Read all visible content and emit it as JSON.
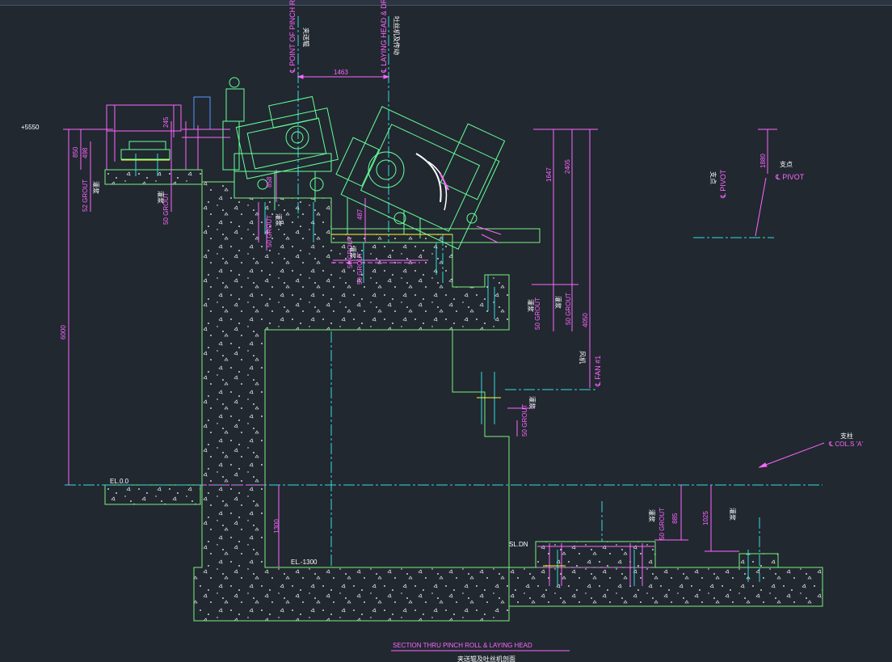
{
  "colors": {
    "background": "#212830",
    "concrete": "#7cf07c",
    "dimension": "#ff66ff",
    "centerline": "#33dddd",
    "equipment": "#66ff99",
    "white": "#ffffff",
    "yellow": "#ffff33",
    "blue": "#5599ff"
  },
  "labels": {
    "pinch_roll_cl": "℄ POINT OF PINCH ROLL",
    "pinch_roll_cn": "夹送辊",
    "laying_head_cl": "℄ LAYING HEAD & DRIVE",
    "laying_head_cn": "吐丝机及传动",
    "dim_1463": "1463",
    "elev_5550": "+5550",
    "dim_850": "850",
    "dim_498": "498",
    "dim_245": "245",
    "dim_6000": "6000",
    "grout_52": "52 GROUT",
    "grout_50_a": "50 GROUT",
    "grout_50_b": "50 GROUT",
    "grout_50_c": "50 GROUT",
    "grout_50_d": "50 GROUT",
    "grout_50_e": "50 GROUT",
    "grout_50_f": "50 GROUT",
    "grout_50_g": "50 GROUT",
    "grout_50_h": "50 GROUT",
    "grout_cn": "灌浆",
    "dim_858": "858",
    "dim_487": "487",
    "dim_1647": "1647",
    "dim_2405": "2405",
    "dim_4050": "4050",
    "fan_label": "℄ FAN #1",
    "fan_cn": "风机",
    "pivot_label": "℄ PIVOT",
    "pivot_cn": "支点",
    "pivot_cn_vert": "支点",
    "dim_1880": "1880",
    "col_label": "℄ COL.S 'A'",
    "col_cn": "支柱",
    "el_00": "EL.0.0",
    "el_1300": "EL.-1300",
    "dim_1300": "1300",
    "sl_dn": "SL.DN",
    "dim_885": "885",
    "dim_1025": "1025",
    "caption_en": "SECTION THRU PINCH ROLL & LAYING HEAD",
    "caption_cn": "夹送辊及吐丝机剖面"
  }
}
